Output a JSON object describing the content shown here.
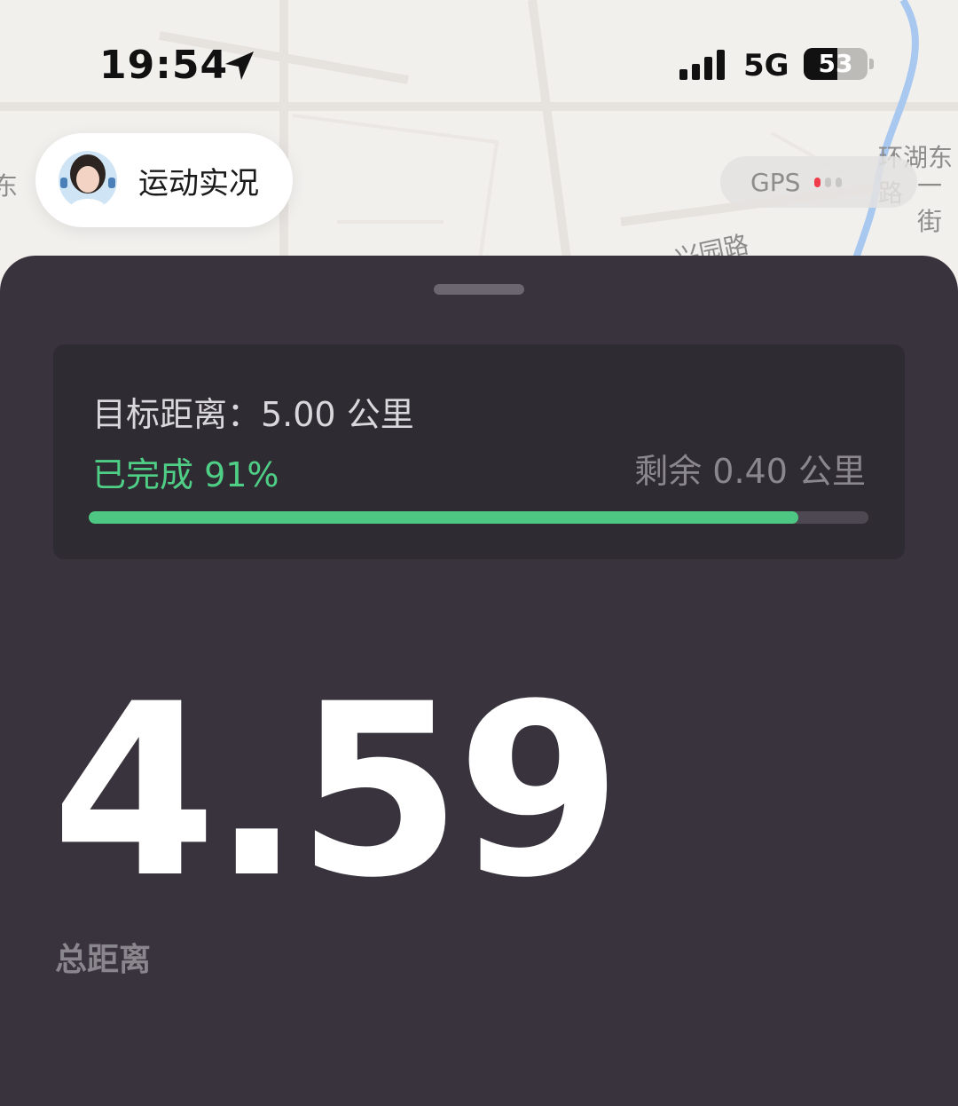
{
  "status_bar": {
    "time": "19:54",
    "network": "5G",
    "battery_text": "53",
    "battery_level_percent": 53
  },
  "map": {
    "labels": [
      "东",
      "环湖东路",
      "一街",
      "兴园路"
    ]
  },
  "live_pill": {
    "label": "运动实况"
  },
  "gps": {
    "label": "GPS",
    "signal_bars_active": 1,
    "signal_bars_total": 3
  },
  "goal_card": {
    "title": "目标距离：5.00 公里",
    "completed": "已完成 91%",
    "remaining": "剩余 0.40 公里",
    "progress_percent": 91
  },
  "summary": {
    "distance_value": "4.59",
    "distance_label": "总距离"
  },
  "colors": {
    "panel_bg": "#38333d",
    "card_bg": "#2f2b33",
    "accent_green": "#4fcf86",
    "gps_red": "#f03c4a",
    "map_water": "#a9c8f0"
  }
}
